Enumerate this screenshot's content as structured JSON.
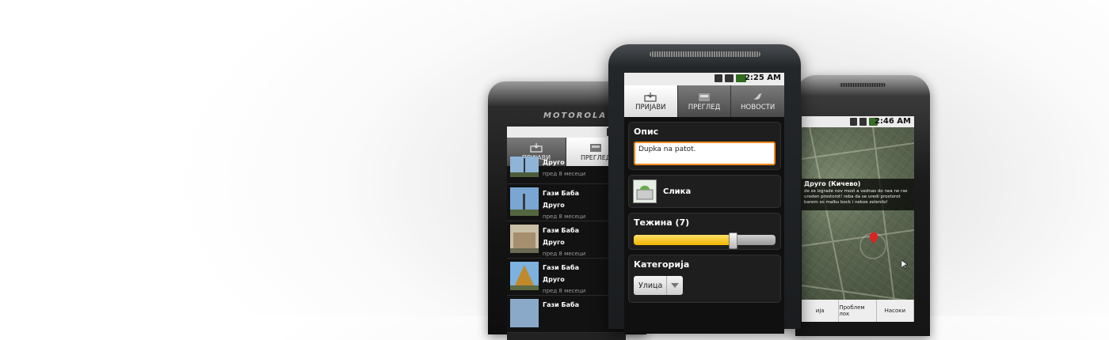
{
  "left_phone": {
    "brand": "MOTOROLA",
    "tabs": [
      {
        "label": "ПРИЈАВИ"
      },
      {
        "label": "ПРЕГЛЕД"
      }
    ],
    "items": [
      {
        "place": "",
        "category": "Друго",
        "time": "пред 8 месеци"
      },
      {
        "place": "Гази Баба",
        "category": "Друго",
        "time": "пред 8 месеци"
      },
      {
        "place": "Гази Баба",
        "category": "Друго",
        "time": "пред 8 месеци"
      },
      {
        "place": "Гази Баба",
        "category": "Друго",
        "time": "пред 8 месеци"
      },
      {
        "place": "Гази Баба",
        "category": "",
        "time": ""
      }
    ]
  },
  "center_phone": {
    "status": {
      "time": "2:25 AM"
    },
    "tabs": [
      {
        "label": "ПРИЈАВИ"
      },
      {
        "label": "ПРЕГЛЕД"
      },
      {
        "label": "НОВОСТИ"
      }
    ],
    "description": {
      "title": "Опис",
      "value": "Dupka na patot."
    },
    "image": {
      "label": "Слика"
    },
    "severity": {
      "title": "Тежина (7)",
      "value": 7,
      "max": 10
    },
    "category": {
      "title": "Категорија",
      "value": "Улица"
    }
  },
  "right_phone": {
    "status": {
      "time": "2:46 AM"
    },
    "popup": {
      "title": "Друго (Кичево)",
      "description": "de se izgrade nov most a vednas do nea ne rse ureden prostorot! reba da se uredi prostorot barem so malku bock i nekoe zelenilo!"
    },
    "bottom_buttons": [
      {
        "label": "ија"
      },
      {
        "label": "Проблем лок"
      },
      {
        "label": "Насоки"
      }
    ]
  },
  "colors": {
    "accent_orange": "#f08a1c",
    "slider_yellow": "#f2b400"
  }
}
